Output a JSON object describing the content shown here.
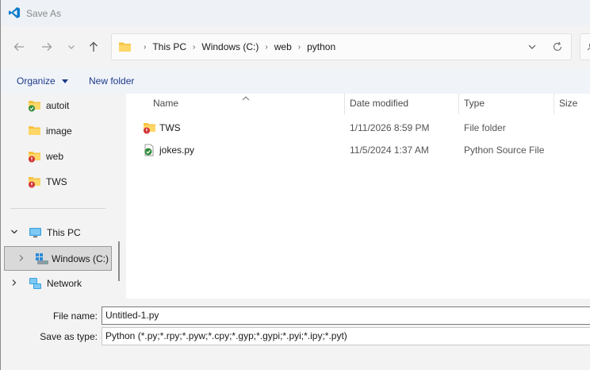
{
  "window": {
    "title": "Save As"
  },
  "address": {
    "crumbs": [
      "This PC",
      "Windows (C:)",
      "web",
      "python"
    ]
  },
  "toolbar": {
    "organize_label": "Organize",
    "new_folder_label": "New folder"
  },
  "sidebar": {
    "quick_items": [
      {
        "label": "autoit",
        "icon": "folder-synced-icon"
      },
      {
        "label": "image",
        "icon": "folder-icon"
      },
      {
        "label": "web",
        "icon": "folder-error-icon"
      },
      {
        "label": "TWS",
        "icon": "folder-error-icon"
      }
    ],
    "this_pc_label": "This PC",
    "windows_label": "Windows (C:)",
    "network_label": "Network"
  },
  "columns": {
    "name": "Name",
    "date": "Date modified",
    "type": "Type",
    "size": "Size"
  },
  "files": [
    {
      "name": "TWS",
      "date": "1/11/2026 8:59 PM",
      "type": "File folder",
      "icon": "folder-error-icon"
    },
    {
      "name": "jokes.py",
      "date": "11/5/2024 1:37 AM",
      "type": "Python Source File",
      "icon": "python-file-synced-icon"
    }
  ],
  "form": {
    "file_name_label": "File name:",
    "file_name_value": "Untitled-1.py",
    "save_type_label": "Save as type:",
    "save_type_value": "Python (*.py;*.rpy;*.pyw;*.cpy;*.gyp;*.gypi;*.pyi;*.ipy;*.pyt)"
  },
  "colors": {
    "accent": "#0067c0",
    "folder": "#f5c242",
    "error": "#d13438",
    "ok": "#2e8b3a"
  }
}
